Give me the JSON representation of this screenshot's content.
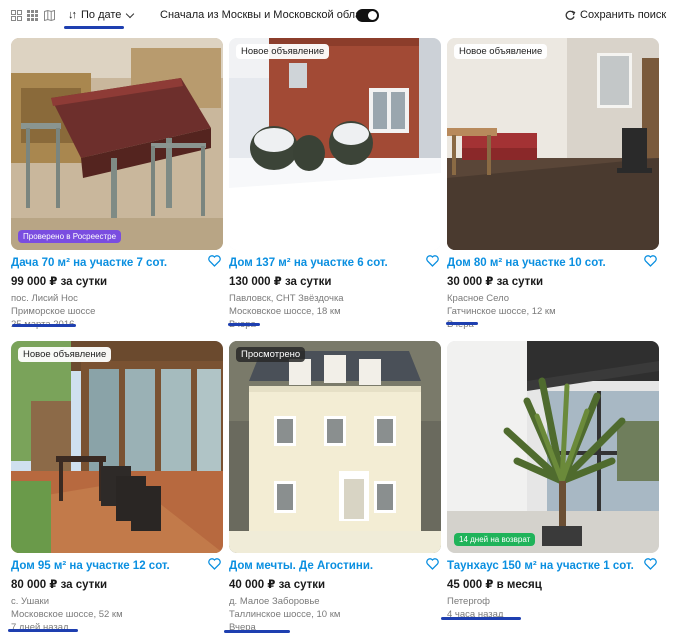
{
  "toolbar": {
    "sort_label": "По дате",
    "filter_label": "Сначала из Москвы и Московской области",
    "filter_enabled": true,
    "save_search_label": "Сохранить поиск"
  },
  "listings": [
    {
      "title": "Дача 70 м² на участке 7 сот.",
      "price": "99 000 ₽ за сутки",
      "line1": "пос. Лисий Нос",
      "line2": "Приморское шоссе",
      "date": "25 марта 2016",
      "badge": "Проверено в Росреестре"
    },
    {
      "title": "Дом 137 м² на участке 6 сот.",
      "price": "130 000 ₽ за сутки",
      "line1": "Павловск, СНТ Звёздочка",
      "line2": "Московское шоссе, 18 км",
      "date": "Вчера",
      "badge": "Новое объявление"
    },
    {
      "title": "Дом 80 м² на участке 10 сот.",
      "price": "30 000 ₽ за сутки",
      "line1": "Красное Село",
      "line2": "Гатчинское шоссе, 12 км",
      "date": "Вчера",
      "badge": "Новое объявление"
    },
    {
      "title": "Дом 95 м² на участке 12 сот.",
      "price": "80 000 ₽ за сутки",
      "line1": "с. Ушаки",
      "line2": "Московское шоссе, 52 км",
      "date": "7 дней назад",
      "badge": "Новое объявление"
    },
    {
      "title": "Дом мечты. Де Агостини.",
      "price": "40 000 ₽ за сутки",
      "line1": "д. Малое Заборовье",
      "line2": "Таллинское шоссе, 10 км",
      "date": "Вчера",
      "badge": "Просмотрено"
    },
    {
      "title": "Таунхаус 150 м² на участке 1 сот.",
      "price": "45 000 ₽ в месяц",
      "line1": "Петергоф",
      "date": "4 часа назад",
      "badge": "14 дней на возврат"
    }
  ]
}
